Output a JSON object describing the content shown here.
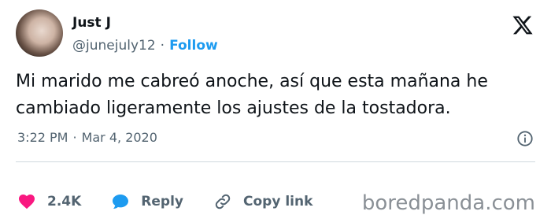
{
  "author": {
    "name": "Just J",
    "handle": "@junejuly12",
    "separator": "·",
    "follow_label": "Follow"
  },
  "tweet": {
    "text": "Mi marido me cabreó anoche, así que esta mañana he cambiado ligeramente los ajustes de la tostadora.",
    "time": "3:22 PM",
    "date_separator": "·",
    "date": "Mar 4, 2020"
  },
  "actions": {
    "like_count": "2.4K",
    "reply_label": "Reply",
    "copy_link_label": "Copy link"
  },
  "watermark": "boredpanda.com",
  "colors": {
    "accent": "#1d9bf0",
    "like": "#f91880",
    "secondary_text": "#536471"
  },
  "icons": {
    "logo": "x-logo-icon",
    "info": "info-icon",
    "like": "heart-icon",
    "reply": "speech-bubble-icon",
    "copy_link": "link-icon"
  }
}
